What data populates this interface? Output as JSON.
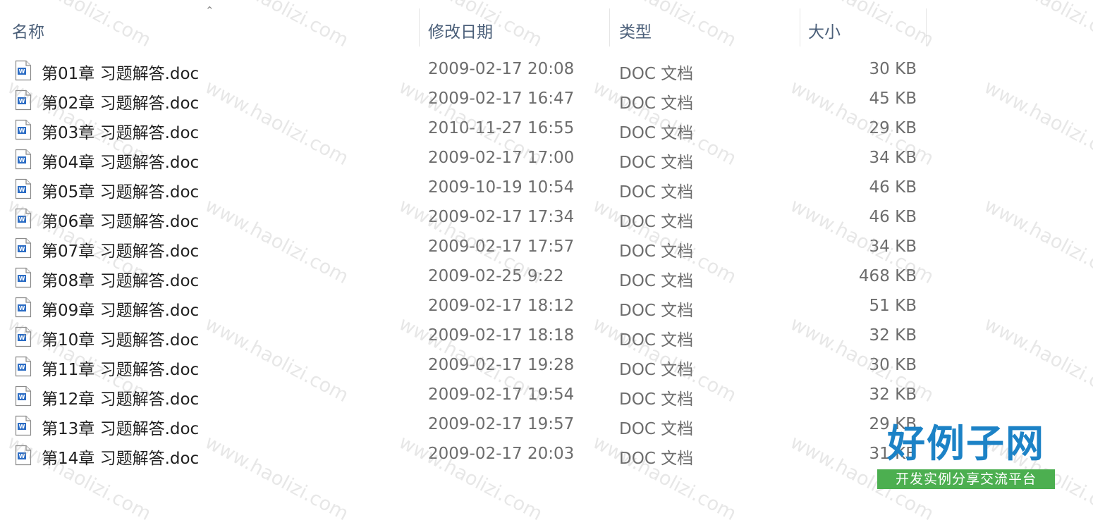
{
  "columns": {
    "name": "名称",
    "modified": "修改日期",
    "type": "类型",
    "size": "大小"
  },
  "files": [
    {
      "name": "第01章 习题解答.doc",
      "modified": "2009-02-17 20:08",
      "type": "DOC 文档",
      "size": "30 KB"
    },
    {
      "name": "第02章 习题解答.doc",
      "modified": "2009-02-17 16:47",
      "type": "DOC 文档",
      "size": "45 KB"
    },
    {
      "name": "第03章 习题解答.doc",
      "modified": "2010-11-27 16:55",
      "type": "DOC 文档",
      "size": "29 KB"
    },
    {
      "name": "第04章 习题解答.doc",
      "modified": "2009-02-17 17:00",
      "type": "DOC 文档",
      "size": "34 KB"
    },
    {
      "name": "第05章 习题解答.doc",
      "modified": "2009-10-19 10:54",
      "type": "DOC 文档",
      "size": "46 KB"
    },
    {
      "name": "第06章 习题解答.doc",
      "modified": "2009-02-17 17:34",
      "type": "DOC 文档",
      "size": "46 KB"
    },
    {
      "name": "第07章 习题解答.doc",
      "modified": "2009-02-17 17:57",
      "type": "DOC 文档",
      "size": "34 KB"
    },
    {
      "name": "第08章 习题解答.doc",
      "modified": "2009-02-25 9:22",
      "type": "DOC 文档",
      "size": "468 KB"
    },
    {
      "name": "第09章 习题解答.doc",
      "modified": "2009-02-17 18:12",
      "type": "DOC 文档",
      "size": "51 KB"
    },
    {
      "name": "第10章 习题解答.doc",
      "modified": "2009-02-17 18:18",
      "type": "DOC 文档",
      "size": "32 KB"
    },
    {
      "name": "第11章 习题解答.doc",
      "modified": "2009-02-17 19:28",
      "type": "DOC 文档",
      "size": "30 KB"
    },
    {
      "name": "第12章 习题解答.doc",
      "modified": "2009-02-17 19:54",
      "type": "DOC 文档",
      "size": "32 KB"
    },
    {
      "name": "第13章 习题解答.doc",
      "modified": "2009-02-17 19:57",
      "type": "DOC 文档",
      "size": "29 KB"
    },
    {
      "name": "第14章 习题解答.doc",
      "modified": "2009-02-17 20:03",
      "type": "DOC 文档",
      "size": "31 KB"
    }
  ],
  "file_icon": "word-doc-icon",
  "watermark_text": "www.haolizi.com",
  "logo": {
    "title": "好例子网",
    "subtitle": "开发实例分享交流平台"
  },
  "colors": {
    "header_text": "#4c607a",
    "name_text": "#1f1f1f",
    "meta_text": "#6d6d6d",
    "logo_blue": "#1c82c6",
    "logo_green": "#4caf50"
  }
}
